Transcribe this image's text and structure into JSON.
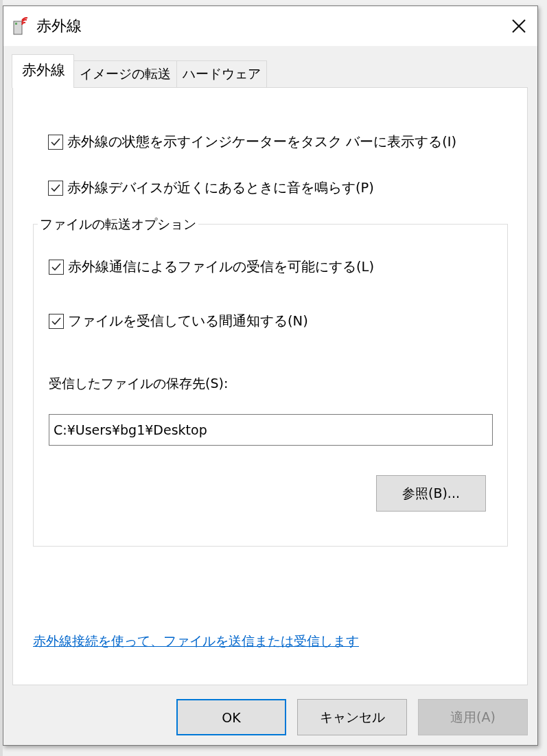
{
  "window": {
    "title": "赤外線"
  },
  "tabs": [
    {
      "label": "赤外線",
      "selected": true
    },
    {
      "label": "イメージの転送",
      "selected": false
    },
    {
      "label": "ハードウェア",
      "selected": false
    }
  ],
  "options": [
    {
      "label": "赤外線の状態を示すインジケーターをタスク バーに表示する(I)",
      "checked": true
    },
    {
      "label": "赤外線デバイスが近くにあるときに音を鳴らす(P)",
      "checked": true
    }
  ],
  "file_transfer": {
    "title": "ファイルの転送オプション",
    "options": [
      {
        "label": "赤外線通信によるファイルの受信を可能にする(L)",
        "checked": true
      },
      {
        "label": "ファイルを受信している間通知する(N)",
        "checked": true
      }
    ],
    "save_label": "受信したファイルの保存先(S):",
    "save_path": "C:¥Users¥bg1¥Desktop",
    "browse_button": "参照(B)..."
  },
  "link": "赤外線接続を使って、ファイルを送信または受信します",
  "buttons": [
    {
      "label": "OK",
      "default": true,
      "disabled": false
    },
    {
      "label": "キャンセル",
      "default": false,
      "disabled": false
    },
    {
      "label": "適用(A)",
      "default": false,
      "disabled": true
    }
  ]
}
